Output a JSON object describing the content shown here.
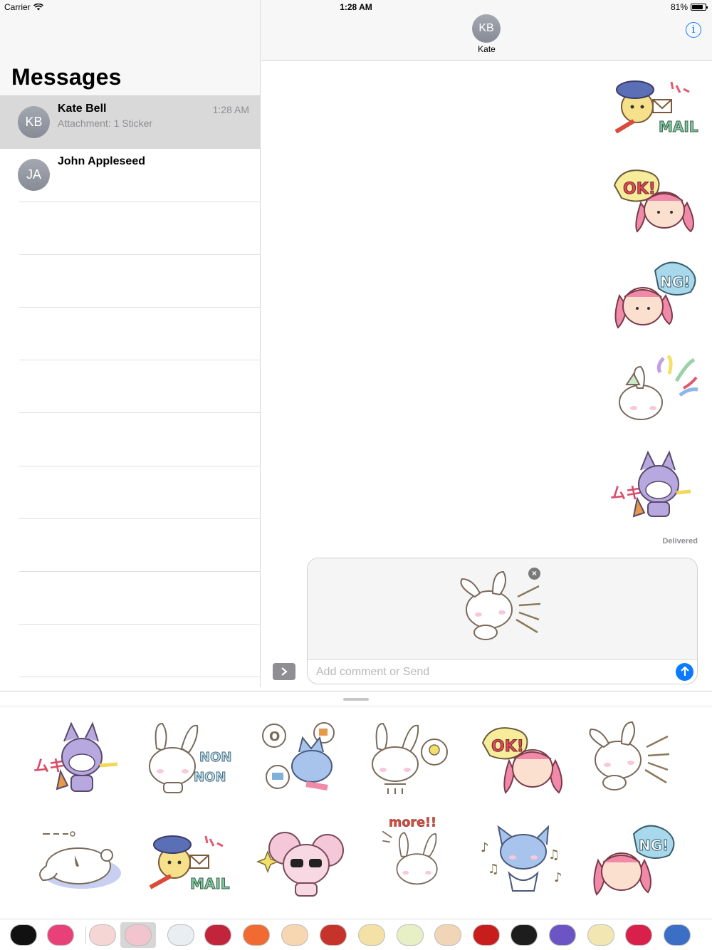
{
  "status_bar": {
    "carrier": "Carrier",
    "time": "1:28 AM",
    "battery": "81%",
    "battery_level": 0.81
  },
  "sidebar": {
    "title": "Messages",
    "conversations": [
      {
        "initials": "KB",
        "name": "Kate Bell",
        "preview": "Attachment: 1 Sticker",
        "time": "1:28 AM",
        "selected": true
      },
      {
        "initials": "JA",
        "name": "John Appleseed",
        "preview": "",
        "time": "",
        "selected": false
      }
    ]
  },
  "chat": {
    "contact_initials": "KB",
    "contact_name": "Kate",
    "info_icon": "info-icon",
    "stickers": [
      "bear-mail-sticker",
      "girl-ok-sticker",
      "girl-ng-sticker",
      "bunny-party-sticker",
      "wolf-angry-sticker"
    ],
    "delivered": "Delivered"
  },
  "compose": {
    "attached_sticker": "bunny-shout-sticker",
    "placeholder": "Add comment or Send",
    "value": ""
  },
  "drawer": {
    "stickers": [
      "wolf-angry-sticker",
      "bunny-non-non-sticker",
      "cat-dreaming-sticker",
      "bunny-idea-sticker",
      "girl-ok-sticker",
      "bunny-shout-sticker",
      "bunny-lying-sticker",
      "bear-mail-sticker",
      "mouse-sunglasses-sticker",
      "bunny-more-sticker",
      "cat-music-sticker",
      "girl-ng-sticker"
    ]
  },
  "tray": {
    "apps": [
      "recents-heart-icon",
      "search-images-icon",
      "bunny-app-icon",
      "bunny-sticker-app-icon",
      "goat-app-icon",
      "relax-app-icon",
      "fox-app-icon",
      "monkey-app-icon",
      "hello-app-icon",
      "alien-app-icon",
      "sorry-app-icon",
      "dog-app-icon",
      "dino-app-icon",
      "chef-app-icon",
      "cool-app-icon",
      "bear-app-icon",
      "devil-app-icon",
      "pet-app-icon"
    ],
    "colors": [
      "#111111",
      "#e8417a",
      "#f6d5d5",
      "#f2c4cd",
      "#e9eef2",
      "#c2243c",
      "#f06a32",
      "#f7d6b2",
      "#c5332b",
      "#f4e1a6",
      "#e7f0c4",
      "#f0d5b7",
      "#c81d1d",
      "#1d1d1d",
      "#6c54c4",
      "#f2e6b2",
      "#d8204a",
      "#3b6ec5"
    ]
  }
}
